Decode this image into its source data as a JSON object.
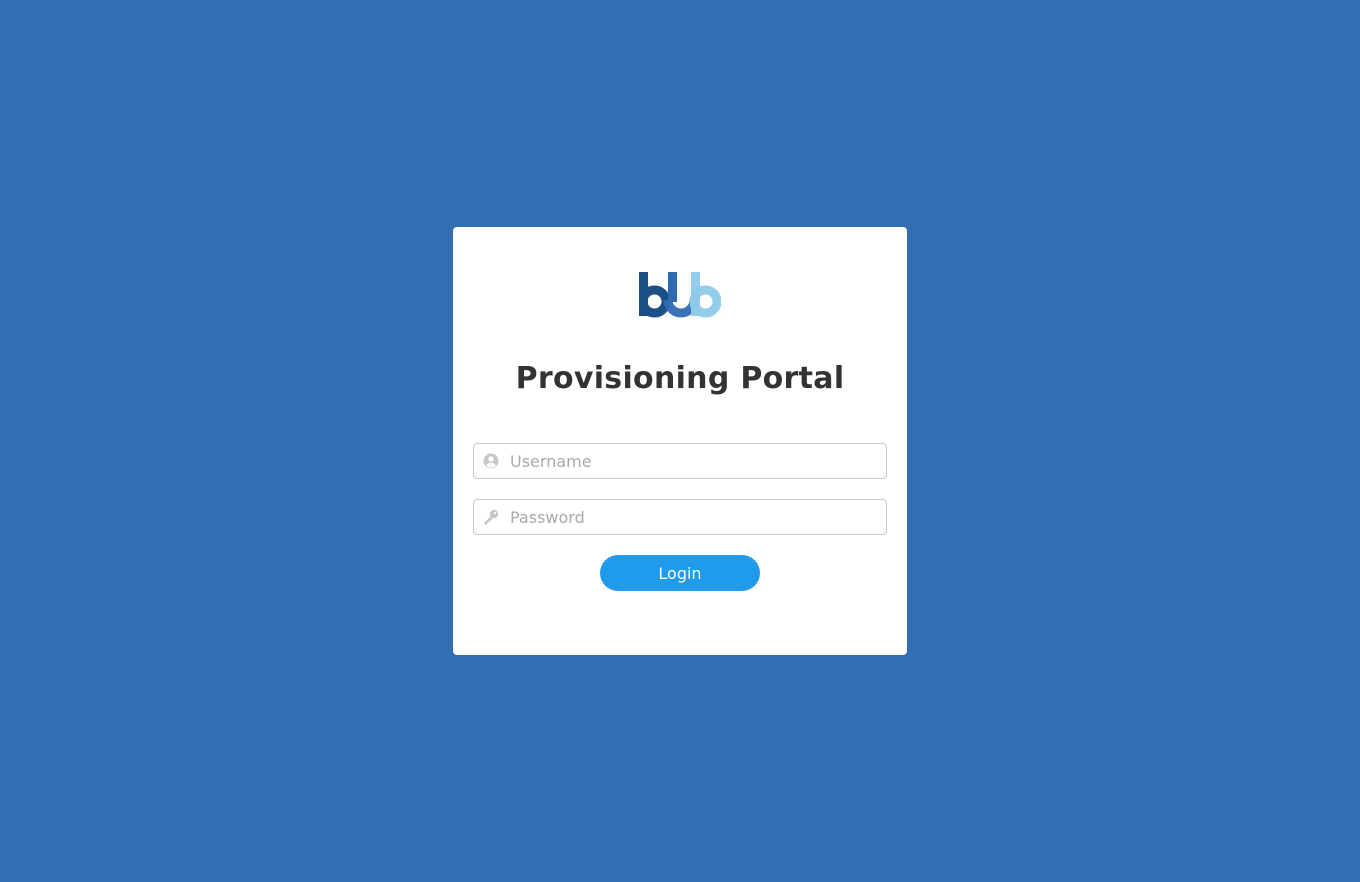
{
  "page": {
    "background_color": "#316eb2"
  },
  "logo": {
    "icon": "btb-logo",
    "colors": [
      "#1c4f86",
      "#2f6bb3",
      "#8ec9ea"
    ]
  },
  "login": {
    "title": "Provisioning Portal",
    "username_placeholder": "Username",
    "username_value": "",
    "username_icon": "user-circle-icon",
    "password_placeholder": "Password",
    "password_value": "",
    "password_icon": "key-icon",
    "button_label": "Login",
    "button_color": "#209bec"
  }
}
